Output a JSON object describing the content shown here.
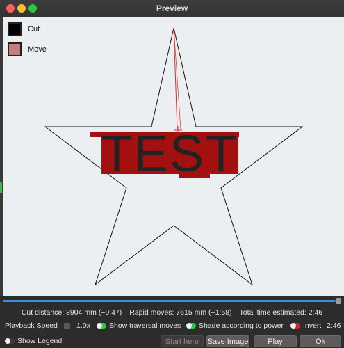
{
  "window": {
    "title": "Preview"
  },
  "legend": {
    "items": [
      {
        "label": "Cut",
        "color": "#000000"
      },
      {
        "label": "Move",
        "color": "#c08080"
      }
    ]
  },
  "preview": {
    "shape": "star",
    "text": "TEST",
    "cut_color": "#111111",
    "fill_color": "#a31010"
  },
  "playback": {
    "progress": 1.0
  },
  "stats": {
    "cut_distance": "Cut distance: 3904 mm (~0:47)",
    "rapid_moves": "Rapid moves: 7615 mm (~1:58)",
    "total_time": "Total time estimated: 2:46"
  },
  "controls": {
    "playback_speed_label": "Playback Speed",
    "speed_value": "1.0x",
    "show_traversal_label": "Show traversal moves",
    "shade_label": "Shade according to power",
    "invert_label": "Invert",
    "time_readout": "2:46",
    "show_legend_label": "Show Legend"
  },
  "buttons": {
    "start_here": "Start here",
    "save_image": "Save Image",
    "play": "Play",
    "ok": "Ok"
  },
  "colors": {
    "accent": "#3f8fd6",
    "toggle_on": "#2ecc40",
    "toggle_invert": "#c62828"
  }
}
